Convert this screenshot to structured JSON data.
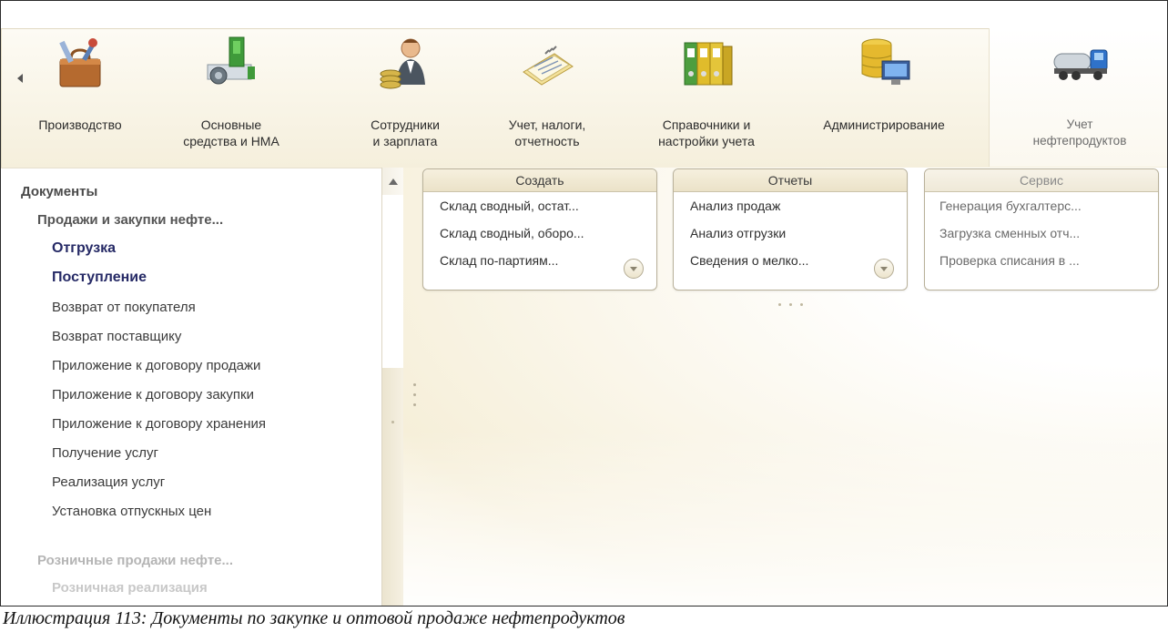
{
  "sections": [
    {
      "label": "Производство",
      "icon": "toolbox-icon"
    },
    {
      "label": "Основные\nсредства и НМА",
      "icon": "machine-tool-icon"
    },
    {
      "label": "Сотрудники\nи зарплата",
      "icon": "employee-coins-icon"
    },
    {
      "label": "Учет, налоги,\nотчетность",
      "icon": "notepad-icon"
    },
    {
      "label": "Справочники и\nнастройки учета",
      "icon": "binders-icon"
    },
    {
      "label": "Администрирование",
      "icon": "database-computer-icon"
    },
    {
      "label": "Учет\nнефтепродуктов",
      "icon": "tanker-truck-icon",
      "active": true
    }
  ],
  "nav": {
    "title": "Документы",
    "group1": "Продажи и закупки нефте...",
    "items": [
      "Отгрузка",
      "Поступление",
      "Возврат от покупателя",
      "Возврат поставщику",
      "Приложение к договору продажи",
      "Приложение к договору закупки",
      "Приложение к договору хранения",
      "Получение услуг",
      "Реализация услуг",
      "Установка отпускных цен"
    ],
    "group2": "Розничные продажи нефте...",
    "item_faded": "Розничная реализация"
  },
  "panels": {
    "create": {
      "title": "Создать",
      "rows": [
        "Склад сводный, остат...",
        "Склад сводный, оборо...",
        "Склад по-партиям..."
      ]
    },
    "reports": {
      "title": "Отчеты",
      "rows": [
        "Анализ продаж",
        "Анализ отгрузки",
        "Сведения о мелко..."
      ]
    },
    "service": {
      "title": "Сервис",
      "rows": [
        "Генерация бухгалтерс...",
        "Загрузка сменных отч...",
        "Проверка списания в ..."
      ]
    }
  },
  "caption": "Иллюстрация 113: Документы по закупке и оптовой продаже нефтепродуктов"
}
